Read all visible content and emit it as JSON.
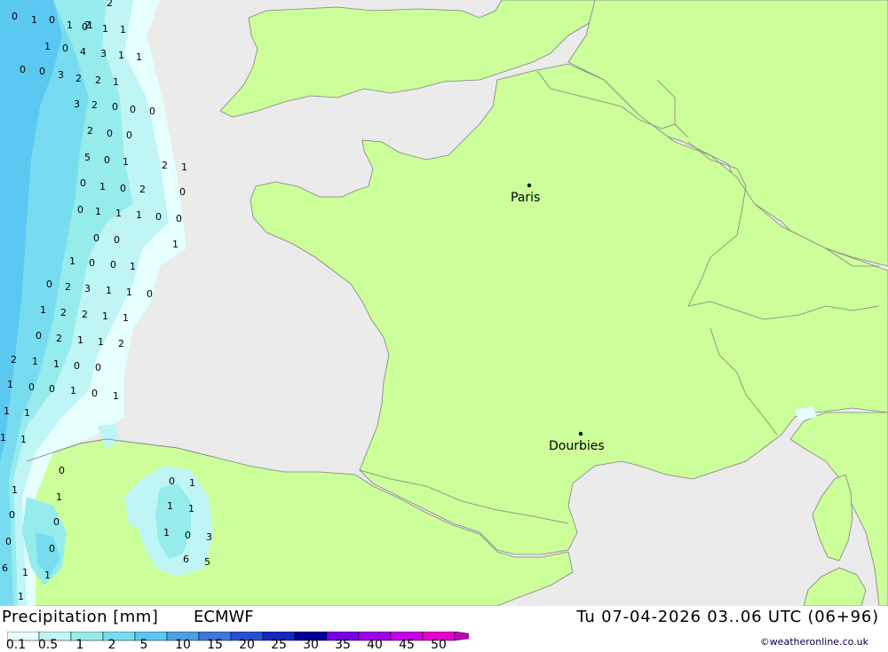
{
  "title": "Precipitation [mm]",
  "model": "ECMWF",
  "datetime": "Tu 07-04-2026 03..06 UTC (06+96)",
  "credit": "©weatheronline.co.uk",
  "cities": [
    {
      "name": "Paris"
    },
    {
      "name": "Dourbies"
    }
  ],
  "legend": {
    "labels": [
      "0.1",
      "0.5",
      "1",
      "2",
      "5",
      "10",
      "15",
      "20",
      "25",
      "30",
      "35",
      "40",
      "45",
      "50"
    ],
    "colors": [
      "#e6ffff",
      "#c0f5f5",
      "#96ebeb",
      "#78dcf0",
      "#5ac8f0",
      "#4ba0e6",
      "#3c78dc",
      "#2850d2",
      "#1428be",
      "#000096",
      "#7800e6",
      "#a000e6",
      "#c800e6",
      "#e600d2",
      "#be00be"
    ]
  },
  "colors": {
    "sea": "#ebebeb",
    "land": "#ccff99",
    "border": "#808080"
  },
  "precip_values": [
    "2",
    "1",
    "0",
    "1",
    "0",
    "1",
    "2",
    "1",
    "1",
    "0",
    "4",
    "3",
    "1",
    "1",
    "1",
    "0",
    "3",
    "2",
    "2",
    "1",
    "0",
    "0",
    "3",
    "2",
    "0",
    "0",
    "0",
    "2",
    "0",
    "0",
    "5",
    "0",
    "1",
    "2",
    "1",
    "0",
    "1",
    "0",
    "2",
    "0",
    "0",
    "1",
    "1",
    "1",
    "0",
    "0",
    "0",
    "0",
    "1",
    "1",
    "0",
    "0",
    "1",
    "0",
    "2",
    "3",
    "1",
    "1",
    "0",
    "1",
    "2",
    "2",
    "1",
    "1",
    "0",
    "2",
    "1",
    "1",
    "2",
    "2",
    "1",
    "1",
    "0",
    "0",
    "1",
    "0",
    "0",
    "1",
    "0",
    "1",
    "1",
    "1",
    "1",
    "1",
    "0",
    "0",
    "1",
    "1",
    "1",
    "1",
    "1",
    "0",
    "0",
    "1",
    "0",
    "3",
    "0",
    "0",
    "6",
    "5",
    "6",
    "1",
    "1",
    "1"
  ]
}
